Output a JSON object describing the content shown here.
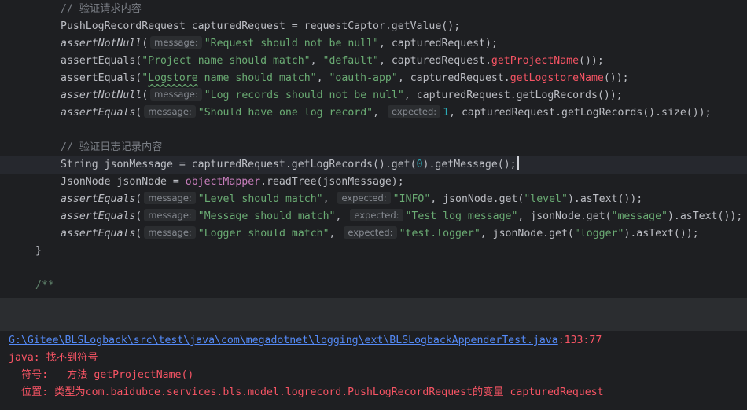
{
  "editor": {
    "comment_verify_request": "// 验证请求内容",
    "line_captured": "PushLogRecordRequest capturedRequest = requestCaptor.getValue();",
    "line_notnull_request": {
      "fn": "assertNotNull",
      "hint": "message:",
      "msg": "\"Request should not be null\"",
      "rest": ", capturedRequest);"
    },
    "line_project": {
      "fn": "assertEquals",
      "msg": "\"Project name should match\"",
      "sep1": ", ",
      "expected": "\"default\"",
      "mid": ", capturedRequest.",
      "method": "getProjectName",
      "rest": "());"
    },
    "line_logstore": {
      "fn": "assertEquals",
      "quote": "\"",
      "word": "Logstore",
      "msg_rest": " name should match\"",
      "sep1": ", ",
      "expected": "\"oauth-app\"",
      "mid": ", capturedRequest.",
      "method": "getLogstoreName",
      "rest": "());"
    },
    "line_notnull_records": {
      "fn": "assertNotNull",
      "hint": "message:",
      "msg": "\"Log records should not be null\"",
      "rest": ", capturedRequest.getLogRecords());"
    },
    "line_one_record": {
      "fn": "assertEquals",
      "hint_msg": "message:",
      "msg": "\"Should have one log record\"",
      "sep1": ", ",
      "hint_exp": "expected:",
      "num": "1",
      "rest": ", capturedRequest.getLogRecords().size());"
    },
    "comment_verify_log": "// 验证日志记录内容",
    "line_json_message": {
      "pre": "String jsonMessage = capturedRequest.getLogRecords().get(",
      "num": "0",
      "rest": ").getMessage();"
    },
    "line_json_node": {
      "pre": "JsonNode jsonNode = ",
      "field": "objectMapper",
      "rest": ".readTree(jsonMessage);"
    },
    "line_level": {
      "fn": "assertEquals",
      "hint_msg": "message:",
      "msg": "\"Level should match\"",
      "sep1": ", ",
      "hint_exp": "expected:",
      "expected": "\"INFO\"",
      "mid": ", jsonNode.get(",
      "key": "\"level\"",
      "rest": ").asText());"
    },
    "line_message": {
      "fn": "assertEquals",
      "hint_msg": "message:",
      "msg": "\"Message should match\"",
      "sep1": ", ",
      "hint_exp": "expected:",
      "expected": "\"Test log message\"",
      "mid": ", jsonNode.get(",
      "key": "\"message\"",
      "rest": ").asText());"
    },
    "line_logger": {
      "fn": "assertEquals",
      "hint_msg": "message:",
      "msg": "\"Logger should match\"",
      "sep1": ", ",
      "hint_exp": "expected:",
      "expected": "\"test.logger\"",
      "mid": ", jsonNode.get(",
      "key": "\"logger\"",
      "rest": ").asText());"
    },
    "close_brace": "}",
    "javadoc_start": "/**",
    "open_paren": "("
  },
  "console": {
    "file_link": "G:\\Gitee\\BLSLogback\\src\\test\\java\\com\\megadotnet\\logging\\ext\\BLSLogbackAppenderTest.java",
    "location": ":133:77",
    "error_line": "java: 找不到符号",
    "symbol_line": "  符号:   方法 getProjectName()",
    "position_line": "  位置: 类型为com.baidubce.services.bls.model.logrecord.PushLogRecordRequest的变量 capturedRequest"
  },
  "colors": {
    "background": "#1e1f22",
    "string": "#6aab73",
    "keyword": "#cf8e6d",
    "error": "#f75464",
    "link": "#548af7",
    "comment": "#7a7e85",
    "number": "#2aacb8",
    "field": "#c77dbb"
  }
}
